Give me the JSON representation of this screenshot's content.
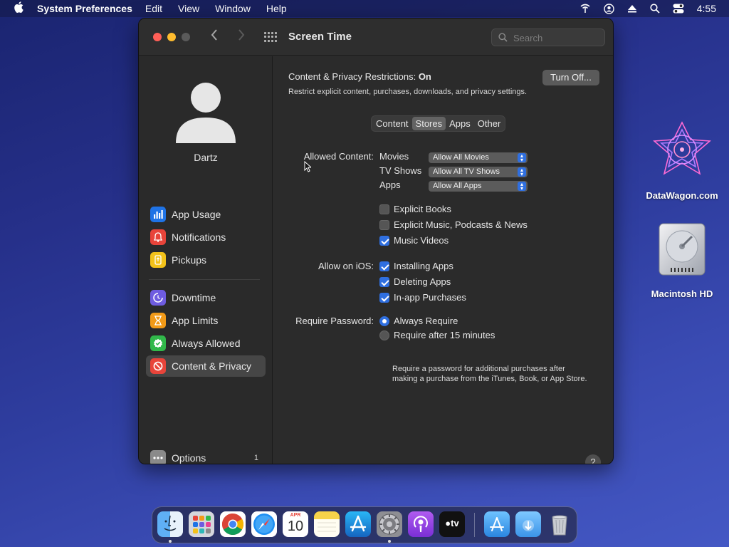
{
  "menubar": {
    "app_name": "System Preferences",
    "menus": [
      "Edit",
      "View",
      "Window",
      "Help"
    ],
    "clock": "4:55"
  },
  "window": {
    "title": "Screen Time",
    "search_placeholder": "Search"
  },
  "sidebar": {
    "user_name": "Dartz",
    "items": [
      {
        "label": "App Usage",
        "icon": "bar-chart-icon",
        "color": "#1f73e6"
      },
      {
        "label": "Notifications",
        "icon": "bell-icon",
        "color": "#e8443a"
      },
      {
        "label": "Pickups",
        "icon": "pickup-icon",
        "color": "#f3c21a"
      },
      {
        "label": "Downtime",
        "icon": "downtime-icon",
        "color": "#6e5ce0"
      },
      {
        "label": "App Limits",
        "icon": "hourglass-icon",
        "color": "#f29a18"
      },
      {
        "label": "Always Allowed",
        "icon": "checkmark-icon",
        "color": "#31b84a"
      },
      {
        "label": "Content & Privacy",
        "icon": "no-entry-icon",
        "color": "#e8443a"
      }
    ],
    "options_label": "Options",
    "options_badge": "1"
  },
  "content": {
    "header_label": "Content & Privacy Restrictions:",
    "header_state": "On",
    "subtitle": "Restrict explicit content, purchases, downloads, and privacy settings.",
    "turn_off_label": "Turn Off...",
    "tabs": [
      "Content",
      "Stores",
      "Apps",
      "Other"
    ],
    "active_tab": "Stores",
    "allowed_content_label": "Allowed Content:",
    "allowed": [
      {
        "label": "Movies",
        "value": "Allow All Movies"
      },
      {
        "label": "TV Shows",
        "value": "Allow All TV Shows"
      },
      {
        "label": "Apps",
        "value": "Allow All Apps"
      }
    ],
    "content_checks": [
      {
        "label": "Explicit Books",
        "checked": false
      },
      {
        "label": "Explicit Music, Podcasts & News",
        "checked": false
      },
      {
        "label": "Music Videos",
        "checked": true
      }
    ],
    "allow_ios_label": "Allow on iOS:",
    "ios_checks": [
      {
        "label": "Installing Apps",
        "checked": true
      },
      {
        "label": "Deleting Apps",
        "checked": true
      },
      {
        "label": "In-app Purchases",
        "checked": true
      }
    ],
    "require_password_label": "Require Password:",
    "password_options": [
      {
        "label": "Always Require",
        "selected": true
      },
      {
        "label": "Require after 15 minutes",
        "selected": false
      }
    ],
    "password_note": "Require a password for additional purchases after making a purchase from the iTunes, Book, or App Store.",
    "help_label": "?"
  },
  "desktop": {
    "icons": [
      {
        "label": "DataWagon.com",
        "icon": "datawagon-logo-icon"
      },
      {
        "label": "Macintosh HD",
        "icon": "hard-drive-icon"
      }
    ]
  },
  "dock": {
    "apps": [
      "Finder",
      "Launchpad",
      "Chrome",
      "Safari",
      "Calendar",
      "Notes",
      "App Store",
      "System Preferences",
      "Podcasts",
      "TV",
      "Applications",
      "Downloads",
      "Trash"
    ],
    "calendar_month": "APR",
    "calendar_day": "10",
    "tv_label": "tv"
  }
}
